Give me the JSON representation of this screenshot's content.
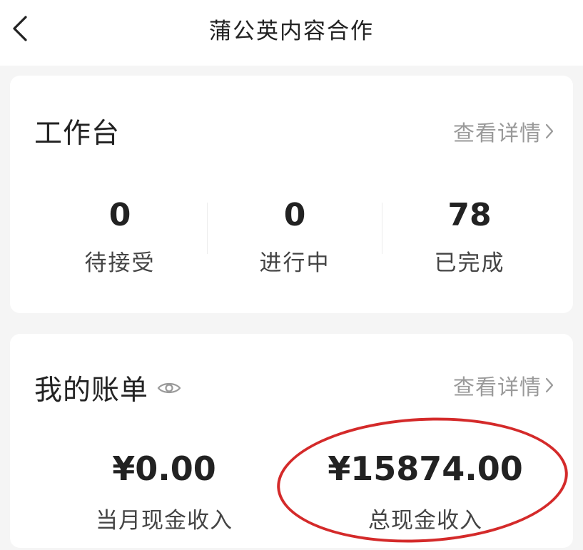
{
  "header": {
    "title": "蒲公英内容合作"
  },
  "workbench": {
    "title": "工作台",
    "detail_label": "查看详情",
    "stats": [
      {
        "value": "0",
        "label": "待接受"
      },
      {
        "value": "0",
        "label": "进行中"
      },
      {
        "value": "78",
        "label": "已完成"
      }
    ]
  },
  "bill": {
    "title": "我的账单",
    "detail_label": "查看详情",
    "monthly": {
      "amount": "¥0.00",
      "label": "当月现金收入"
    },
    "total": {
      "amount": "¥15874.00",
      "label": "总现金收入"
    }
  },
  "colors": {
    "annotation_ring": "#d42a2a",
    "muted_text": "#9a9a9a"
  },
  "icons": [
    "back-arrow-icon",
    "chevron-right-icon",
    "eye-icon"
  ]
}
